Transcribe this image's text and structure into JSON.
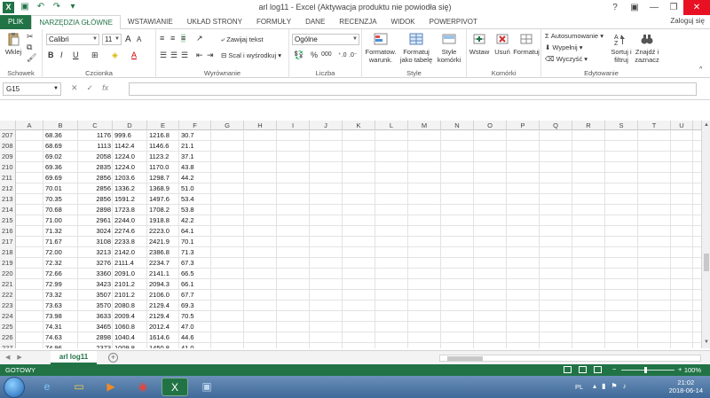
{
  "window": {
    "title": "arl log11 -  Excel (Aktywacja produktu nie powiodła się)",
    "minimize": "—",
    "restore": "❐",
    "close": "✕",
    "help": "?",
    "ribbon_opts": "▣"
  },
  "ribbon_tabs": [
    "PLIK",
    "NARZĘDZIA GŁÓWNE",
    "WSTAWIANIE",
    "UKŁAD STRONY",
    "FORMUŁY",
    "DANE",
    "RECENZJA",
    "WIDOK",
    "POWERPIVOT"
  ],
  "login_label": "Zaloguj się",
  "ribbon": {
    "clipboard": {
      "paste": "Wklej",
      "label": "Schowek"
    },
    "font": {
      "name": "Calibri",
      "size": "11",
      "label": "Czcionka",
      "bold": "B",
      "italic": "I",
      "underline": "U",
      "grow": "A",
      "shrink": "A"
    },
    "alignment": {
      "wrap": "Zawijaj tekst",
      "merge": "Scal i wyśrodkuj",
      "label": "Wyrównanie"
    },
    "number": {
      "format": "Ogólne",
      "percent": "%",
      "thousands": "000",
      "label": "Liczba"
    },
    "styles": {
      "conditional": "Formatow. warunk.",
      "as_table": "Formatuj jako tabelę",
      "cell_styles": "Style komórki",
      "label": "Style"
    },
    "cells": {
      "insert": "Wstaw",
      "delete": "Usuń",
      "format": "Formatuj",
      "label": "Komórki"
    },
    "editing": {
      "autosum": "Autosumowanie",
      "fill": "Wypełnij",
      "clear": "Wyczyść",
      "sort": "Sortuj i filtruj",
      "find": "Znajdź i zaznacz",
      "label": "Edytowanie"
    }
  },
  "formula_bar": {
    "namebox": "G15",
    "cancel": "✕",
    "enter": "✓",
    "fx": "fx",
    "value": ""
  },
  "columns": [
    "A",
    "B",
    "C",
    "D",
    "E",
    "F",
    "G",
    "H",
    "I",
    "J",
    "K",
    "L",
    "M",
    "N",
    "O",
    "P",
    "Q",
    "R",
    "S",
    "T",
    "U"
  ],
  "rows": [
    {
      "n": "207",
      "b": "68.36",
      "c": "1176",
      "d": "999.6",
      "e": "1216.8",
      "f": "30.7"
    },
    {
      "n": "208",
      "b": "68.69",
      "c": "1113",
      "d": "1142.4",
      "e": "1146.6",
      "f": "21.1"
    },
    {
      "n": "209",
      "b": "69.02",
      "c": "2058",
      "d": "1224.0",
      "e": "1123.2",
      "f": "37.1"
    },
    {
      "n": "210",
      "b": "69.36",
      "c": "2835",
      "d": "1224.0",
      "e": "1170.0",
      "f": "43.8"
    },
    {
      "n": "211",
      "b": "69.69",
      "c": "2856",
      "d": "1203.6",
      "e": "1298.7",
      "f": "44.2"
    },
    {
      "n": "212",
      "b": "70.01",
      "c": "2856",
      "d": "1336.2",
      "e": "1368.9",
      "f": "51.0"
    },
    {
      "n": "213",
      "b": "70.35",
      "c": "2856",
      "d": "1591.2",
      "e": "1497.6",
      "f": "53.4"
    },
    {
      "n": "214",
      "b": "70.68",
      "c": "2898",
      "d": "1723.8",
      "e": "1708.2",
      "f": "53.8"
    },
    {
      "n": "215",
      "b": "71.00",
      "c": "2961",
      "d": "2244.0",
      "e": "1918.8",
      "f": "42.2"
    },
    {
      "n": "216",
      "b": "71.32",
      "c": "3024",
      "d": "2274.6",
      "e": "2223.0",
      "f": "64.1"
    },
    {
      "n": "217",
      "b": "71.67",
      "c": "3108",
      "d": "2233.8",
      "e": "2421.9",
      "f": "70.1"
    },
    {
      "n": "218",
      "b": "72.00",
      "c": "3213",
      "d": "2142.0",
      "e": "2386.8",
      "f": "71.3"
    },
    {
      "n": "219",
      "b": "72.32",
      "c": "3276",
      "d": "2111.4",
      "e": "2234.7",
      "f": "67.3"
    },
    {
      "n": "220",
      "b": "72.66",
      "c": "3360",
      "d": "2091.0",
      "e": "2141.1",
      "f": "66.5"
    },
    {
      "n": "221",
      "b": "72.99",
      "c": "3423",
      "d": "2101.2",
      "e": "2094.3",
      "f": "66.1"
    },
    {
      "n": "222",
      "b": "73.32",
      "c": "3507",
      "d": "2101.2",
      "e": "2106.0",
      "f": "67.7"
    },
    {
      "n": "223",
      "b": "73.63",
      "c": "3570",
      "d": "2080.8",
      "e": "2129.4",
      "f": "69.3"
    },
    {
      "n": "224",
      "b": "73.98",
      "c": "3633",
      "d": "2009.4",
      "e": "2129.4",
      "f": "70.5"
    },
    {
      "n": "225",
      "b": "74.31",
      "c": "3465",
      "d": "1060.8",
      "e": "2012.4",
      "f": "47.0"
    },
    {
      "n": "226",
      "b": "74.63",
      "c": "2898",
      "d": "1040.4",
      "e": "1614.6",
      "f": "44.6"
    },
    {
      "n": "227",
      "b": "74.96",
      "c": "2373",
      "d": "1009.8",
      "e": "1450.8",
      "f": "41.0"
    }
  ],
  "sheet_tab": "arl log11",
  "status": {
    "ready": "GOTOWY",
    "zoom": "100%"
  },
  "taskbar": {
    "lang": "PL",
    "time": "21:02",
    "date": "2018-06-14"
  },
  "colors": {
    "excel_green": "#217346"
  }
}
